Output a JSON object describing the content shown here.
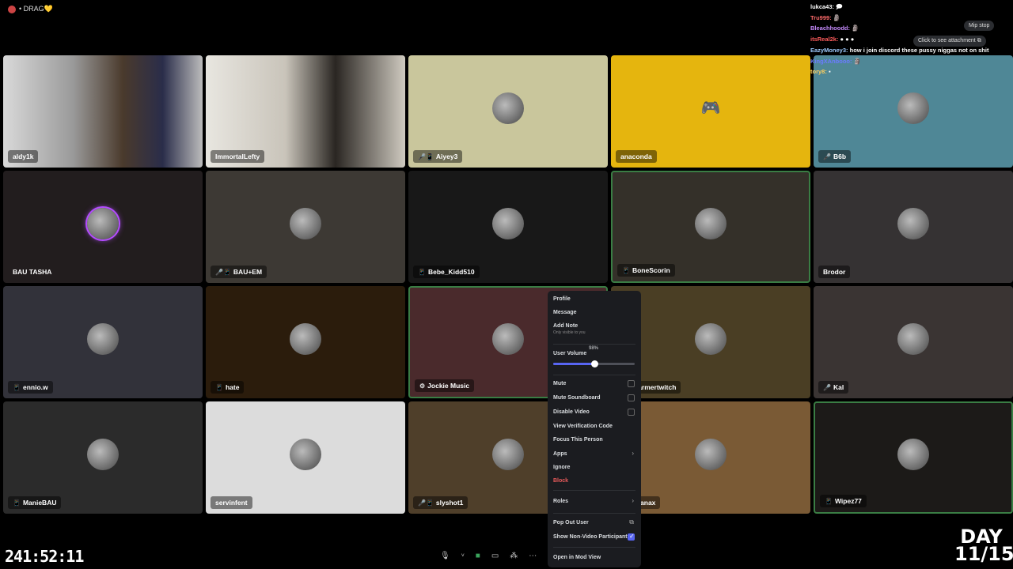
{
  "stream": {
    "title": "• DRAG💛",
    "timer": "241:52:11",
    "day_line1": "DAY",
    "day_line2": "11/15"
  },
  "tiles": [
    {
      "name": "aldy1k",
      "color": "#3b3a3a",
      "video": true
    },
    {
      "name": "ImmortalLefty",
      "color": "#8f8a82",
      "video": true
    },
    {
      "name": "Aiyey3",
      "color": "#c9c69c",
      "icons": "🎤📱"
    },
    {
      "name": "anaconda",
      "color": "#e5b50e"
    },
    {
      "name": "B6b",
      "color": "#4f8796",
      "icons": "🎤"
    },
    {
      "name": "BAU TASHA",
      "color": "#221d1e"
    },
    {
      "name": "BAU+EM",
      "color": "#3d3934",
      "icons": "🎤📱"
    },
    {
      "name": "Bebe_Kidd510",
      "color": "#181818",
      "icons": "📱"
    },
    {
      "name": "BoneScorin",
      "color": "#343029",
      "icons": "📱",
      "speaking": true
    },
    {
      "name": "Brodor",
      "color": "#353233"
    },
    {
      "name": "ennio.w",
      "color": "#32323a",
      "icons": "📱"
    },
    {
      "name": "hate",
      "color": "#2b1c0c",
      "icons": "📱"
    },
    {
      "name": "Jockie Music",
      "color": "#4a2a2c",
      "icons": "⚙",
      "speaking": true
    },
    {
      "name": "ilashfarmertwitch",
      "color": "#4a3e24"
    },
    {
      "name": "Kal",
      "color": "#3a3433",
      "icons": "🎤"
    },
    {
      "name": "ManieBAU",
      "color": "#2b2b2b",
      "icons": "📱"
    },
    {
      "name": "servinfent",
      "color": "#dcdcdc"
    },
    {
      "name": "slyshot1",
      "color": "#4f3f2a",
      "icons": "🎤📱"
    },
    {
      "name": "steofxanax",
      "color": "#7a5a35"
    },
    {
      "name": "Wipez77",
      "color": "#1c1a18",
      "icons": "📱",
      "speaking": true
    }
  ],
  "context_menu": {
    "profile": "Profile",
    "message": "Message",
    "add_note": "Add Note",
    "add_note_sub": "Only visible to you",
    "user_volume": "User Volume",
    "volume_value": "98%",
    "volume_fraction": 0.5,
    "mute": "Mute",
    "mute_soundboard": "Mute Soundboard",
    "disable_video": "Disable Video",
    "view_verification": "View Verification Code",
    "focus": "Focus This Person",
    "apps": "Apps",
    "ignore": "Ignore",
    "block": "Block",
    "roles": "Roles",
    "pop_out": "Pop Out User",
    "show_non_video": "Show Non-Video Participants",
    "open_mod_view": "Open in Mod View"
  },
  "chat": [
    {
      "user": "lukca43:",
      "msg": "🗩",
      "color": "#ffffff"
    },
    {
      "user": "Tru999:",
      "msg": "🗿",
      "color": "#ff6b6b"
    },
    {
      "user": "Bleachhoodd:",
      "msg": "🗿",
      "color": "#c88cff"
    },
    {
      "user": "itsReal2k:",
      "msg": "● ● ●",
      "color": "#ff5c5c"
    },
    {
      "user": "EazyMoney3:",
      "msg": "how i join discord these pussy niggas not on shit",
      "color": "#9ecbff"
    },
    {
      "user": "KingXAnbooo:",
      "msg": "🗿",
      "color": "#6b7bff"
    },
    {
      "user": "tory8:",
      "msg": "▪",
      "color": "#ffcf5c"
    }
  ],
  "overlays": {
    "mip_stop": "Mip stop",
    "click_attachment": "Click to see attachment"
  }
}
